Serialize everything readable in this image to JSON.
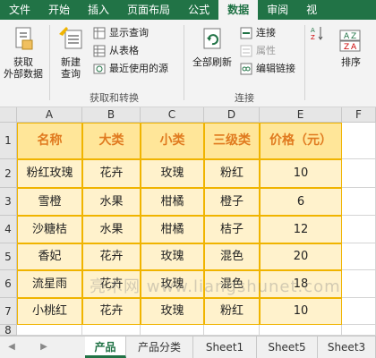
{
  "ribbon_tabs": [
    "文件",
    "开始",
    "插入",
    "页面布局",
    "公式",
    "数据",
    "审阅",
    "视"
  ],
  "active_tab_index": 5,
  "ribbon": {
    "get_external": "获取\n外部数据",
    "new_query": "新建\n查询",
    "show_queries": "显示查询",
    "from_table": "从表格",
    "recent_sources": "最近使用的源",
    "group1_label": "获取和转换",
    "refresh_all": "全部刷新",
    "connections": "连接",
    "properties": "属性",
    "edit_links": "编辑链接",
    "group2_label": "连接",
    "sort": "排序"
  },
  "columns": [
    "A",
    "B",
    "C",
    "D",
    "E",
    "F"
  ],
  "rows": [
    "1",
    "2",
    "3",
    "4",
    "5",
    "6",
    "7",
    "8"
  ],
  "table": {
    "headers": [
      "名称",
      "大类",
      "小类",
      "三级类",
      "价格（元）"
    ],
    "data": [
      [
        "粉红玫瑰",
        "花卉",
        "玫瑰",
        "粉红",
        "10"
      ],
      [
        "雪橙",
        "水果",
        "柑橘",
        "橙子",
        "6"
      ],
      [
        "沙糖桔",
        "水果",
        "柑橘",
        "桔子",
        "12"
      ],
      [
        "香妃",
        "花卉",
        "玫瑰",
        "混色",
        "20"
      ],
      [
        "流星雨",
        "花卉",
        "玫瑰",
        "混色",
        "18"
      ],
      [
        "小桃红",
        "花卉",
        "玫瑰",
        "粉红",
        "10"
      ]
    ]
  },
  "sheet_tabs": [
    "产品",
    "产品分类",
    "Sheet1",
    "Sheet5",
    "Sheet3"
  ],
  "active_sheet_index": 0,
  "watermark": "亮术网 www.liangshunet.com",
  "colors": {
    "excel_green": "#217346",
    "header_fill": "#ffe699",
    "header_text": "#e07a1f",
    "body_fill": "#fff2cc"
  }
}
